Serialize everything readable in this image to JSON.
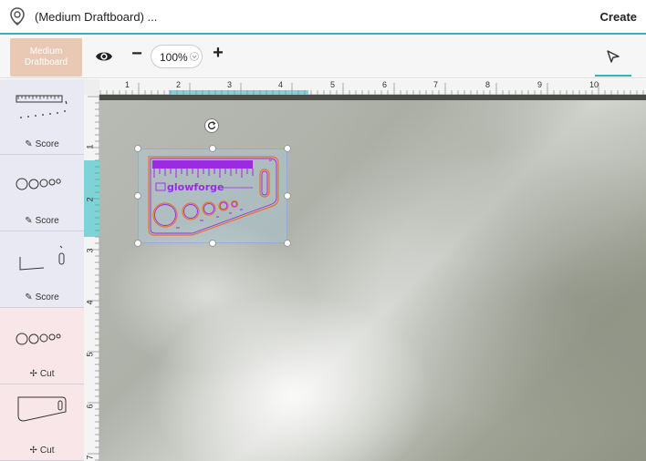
{
  "header": {
    "title": "(Medium Draftboard) ...",
    "create_label": "Create"
  },
  "toolbar": {
    "material_label": "Medium Draftboard",
    "zoom_value": "100%",
    "zoom_minus": "−",
    "zoom_plus": "+"
  },
  "steps": [
    {
      "action": "Score",
      "glyph": "✎"
    },
    {
      "action": "Score",
      "glyph": "✎"
    },
    {
      "action": "Score",
      "glyph": "✎"
    },
    {
      "action": "Cut",
      "glyph": "✢"
    },
    {
      "action": "Cut",
      "glyph": "✢"
    }
  ],
  "ruler": {
    "top": [
      "1",
      "2",
      "3",
      "4",
      "5",
      "6",
      "7",
      "8",
      "9",
      "10"
    ],
    "left": [
      "1",
      "2",
      "3",
      "4",
      "5",
      "6",
      "7"
    ]
  },
  "canvas": {
    "artwork_text": "glowforge"
  },
  "colors": {
    "accent": "#33b3b8",
    "material": "#e9c8b4",
    "score_step": "#e8e9f3",
    "cut_step": "#f8e6e8",
    "engrave": "#9a2be0",
    "cut_line": "#e8732c"
  }
}
